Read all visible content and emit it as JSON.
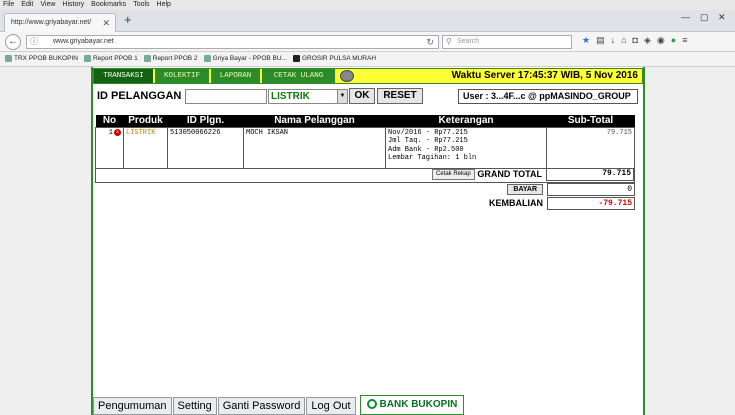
{
  "browser": {
    "menu": [
      "File",
      "Edit",
      "View",
      "History",
      "Bookmarks",
      "Tools",
      "Help"
    ],
    "tab_title": "http://www.griyabayar.net/",
    "url": "www.griyabayar.net",
    "search_placeholder": "Search",
    "bookmarks": [
      "TRX PPOB BUKOPIN",
      "Report PPOB 1",
      "Report PPOB 2",
      "Griya Bayar - PPOB BU...",
      "GROSIR PULSA MURAH"
    ]
  },
  "nav": {
    "tabs": [
      "TRANSAKSI",
      "KOLEKTIF",
      "LAPORAN",
      "CETAK ULANG"
    ],
    "server_time": "Waktu Server 17:45:37 WIB, 5 Nov 2016"
  },
  "form": {
    "id_label": "ID PELANGGAN :",
    "id_value": "",
    "product_selected": "LISTRIK",
    "ok_label": "OK",
    "reset_label": "RESET",
    "user_text": "User : 3...4F...c @ ppMASINDO_GROUP"
  },
  "table": {
    "headers": [
      "No",
      "Produk",
      "ID Plgn.",
      "Nama Pelanggan",
      "Keterangan",
      "Sub-Total"
    ],
    "rows": [
      {
        "no": "1",
        "produk": "LISTRIK",
        "id": "513050066226",
        "nama": "MOCH IKSAN",
        "keterangan": "Nov/2016 - Rp77.215\nJml Taq. - Rp77.215\nAdm Bank - Rp2.500\nLembar Tagihan: 1 bln",
        "subtotal": "79.715"
      }
    ]
  },
  "summary": {
    "cetak_label": "Cetak Rekap",
    "grand_total_label": "GRAND TOTAL",
    "grand_total": "79.715",
    "bayar_label": "BAYAR",
    "bayar_value": "0",
    "kembalian_label": "KEMBALIAN",
    "kembalian": "-79.715"
  },
  "bottom": {
    "items": [
      "Pengumuman",
      "Setting",
      "Ganti Password",
      "Log Out"
    ],
    "bank": "BANK BUKOPIN"
  }
}
